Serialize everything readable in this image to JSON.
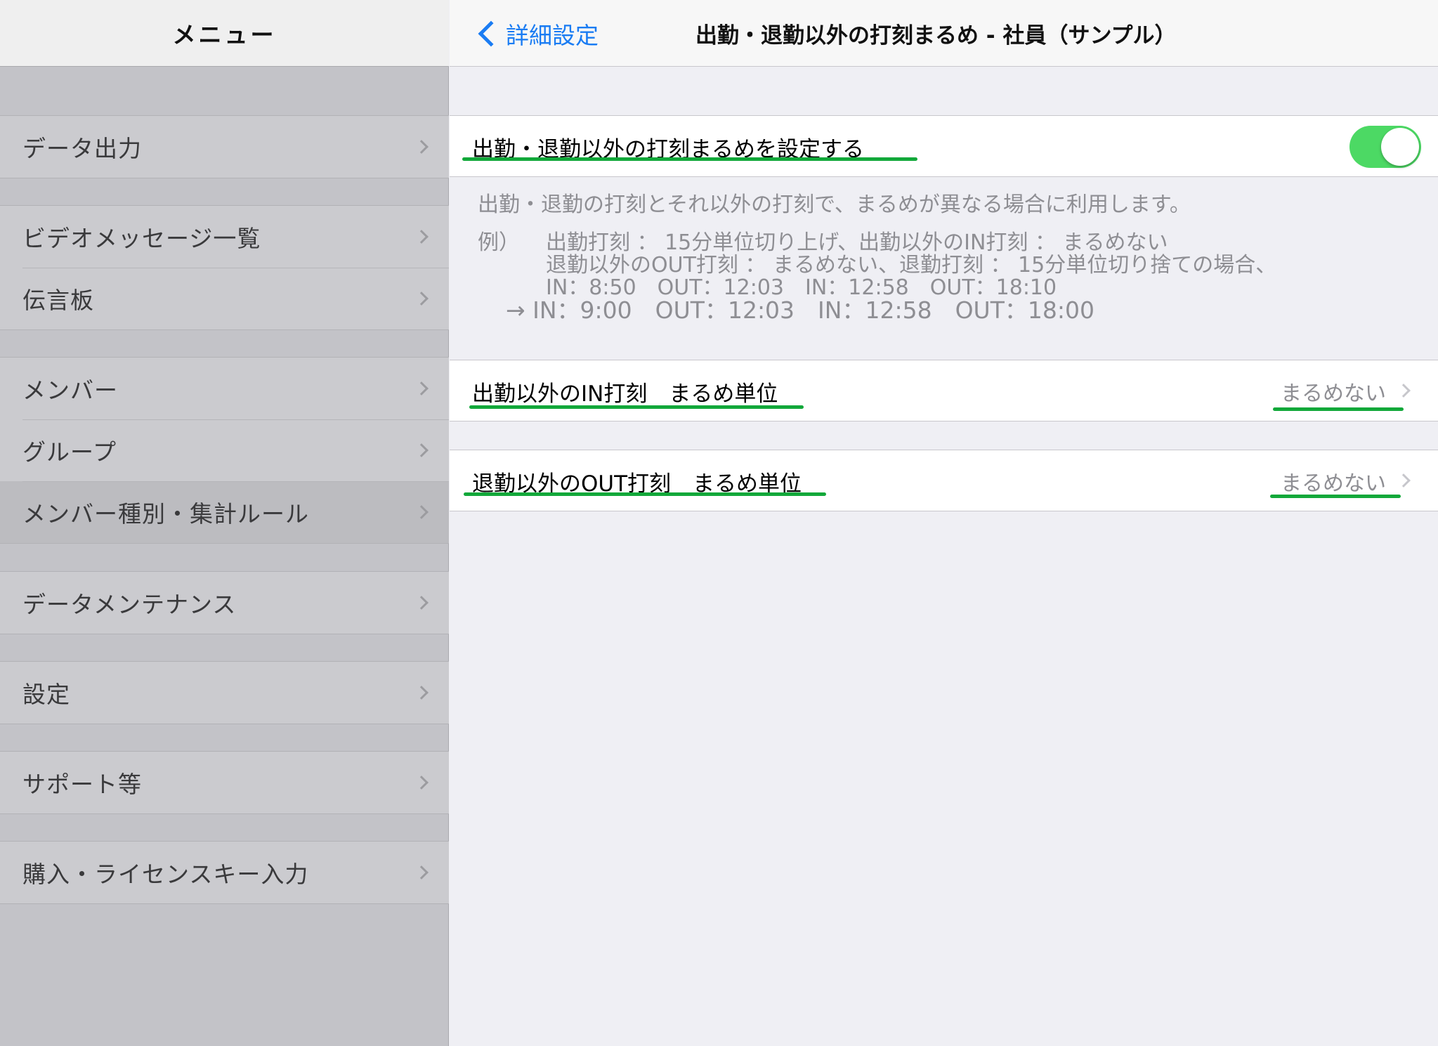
{
  "sidebar": {
    "title": "メニュー",
    "groups": [
      {
        "items": [
          {
            "label": "データ出力"
          }
        ]
      },
      {
        "items": [
          {
            "label": "ビデオメッセージ一覧"
          },
          {
            "label": "伝言板"
          }
        ]
      },
      {
        "items": [
          {
            "label": "メンバー"
          },
          {
            "label": "グループ"
          },
          {
            "label": "メンバー種別・集計ルール",
            "selected": true
          }
        ]
      },
      {
        "items": [
          {
            "label": "データメンテナンス"
          }
        ]
      },
      {
        "items": [
          {
            "label": "設定"
          }
        ]
      },
      {
        "items": [
          {
            "label": "サポート等"
          }
        ]
      },
      {
        "items": [
          {
            "label": "購入・ライセンスキー入力"
          }
        ]
      }
    ]
  },
  "navbar": {
    "back_label": "詳細設定",
    "title": "出勤・退勤以外の打刻まるめ - 社員（サンプル）"
  },
  "settings": {
    "toggle_row": {
      "label": "出勤・退勤以外の打刻まるめを設定する",
      "enabled": true
    },
    "description": "出勤・退勤の打刻とそれ以外の打刻で、まるめが異なる場合に利用します。",
    "example": {
      "label": "例）",
      "line1": "出勤打刻 ： 15分単位切り上げ、出勤以外のIN打刻 ： まるめない",
      "line2": "退勤以外のOUT打刻 ： まるめない、退勤打刻 ： 15分単位切り捨ての場合、",
      "line3": "IN：8:50　OUT：12:03　IN：12:58　OUT：18:10",
      "result": "→ IN：9:00　OUT：12:03　IN：12:58　OUT：18:00"
    },
    "in_row": {
      "label": "出勤以外のIN打刻　まるめ単位",
      "value": "まるめない"
    },
    "out_row": {
      "label": "退勤以外のOUT打刻　まるめ単位",
      "value": "まるめない"
    }
  },
  "colors": {
    "accent": "#1a7cf3",
    "toggle_on": "#4cd964",
    "highlight_underline": "#12a83a"
  }
}
